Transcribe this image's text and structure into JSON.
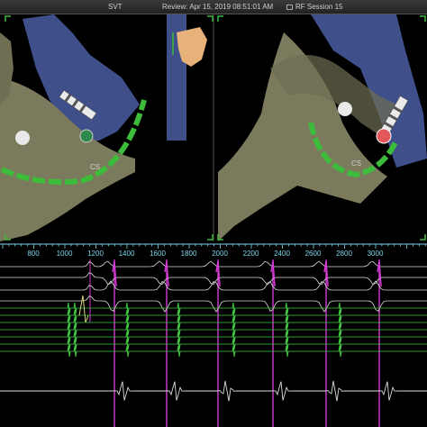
{
  "header": {
    "rhythm": "SVT",
    "review": "Review: Apr 15, 2019 08:51:01 AM",
    "session": "RF Session 15"
  },
  "map": {
    "catheter_label_left": "CS",
    "catheter_label_right": "CS",
    "anatomy_color": "#7c7a5c",
    "venous_color": "#3e4f8a",
    "catheter_color": "#3dbb3a",
    "ablation_color": "#e2585a"
  },
  "timeline": {
    "tick_labels": [
      "800",
      "1000",
      "1200",
      "1400",
      "1600",
      "1800",
      "2000",
      "2200",
      "2400",
      "2600",
      "2800",
      "3000"
    ]
  },
  "signals": {
    "trace_color": "#dcdcdc",
    "cs_trace_color": "#3ec93e",
    "ablation_marker_color": "#d23ad2",
    "ruler_color": "#7ad5e8"
  }
}
